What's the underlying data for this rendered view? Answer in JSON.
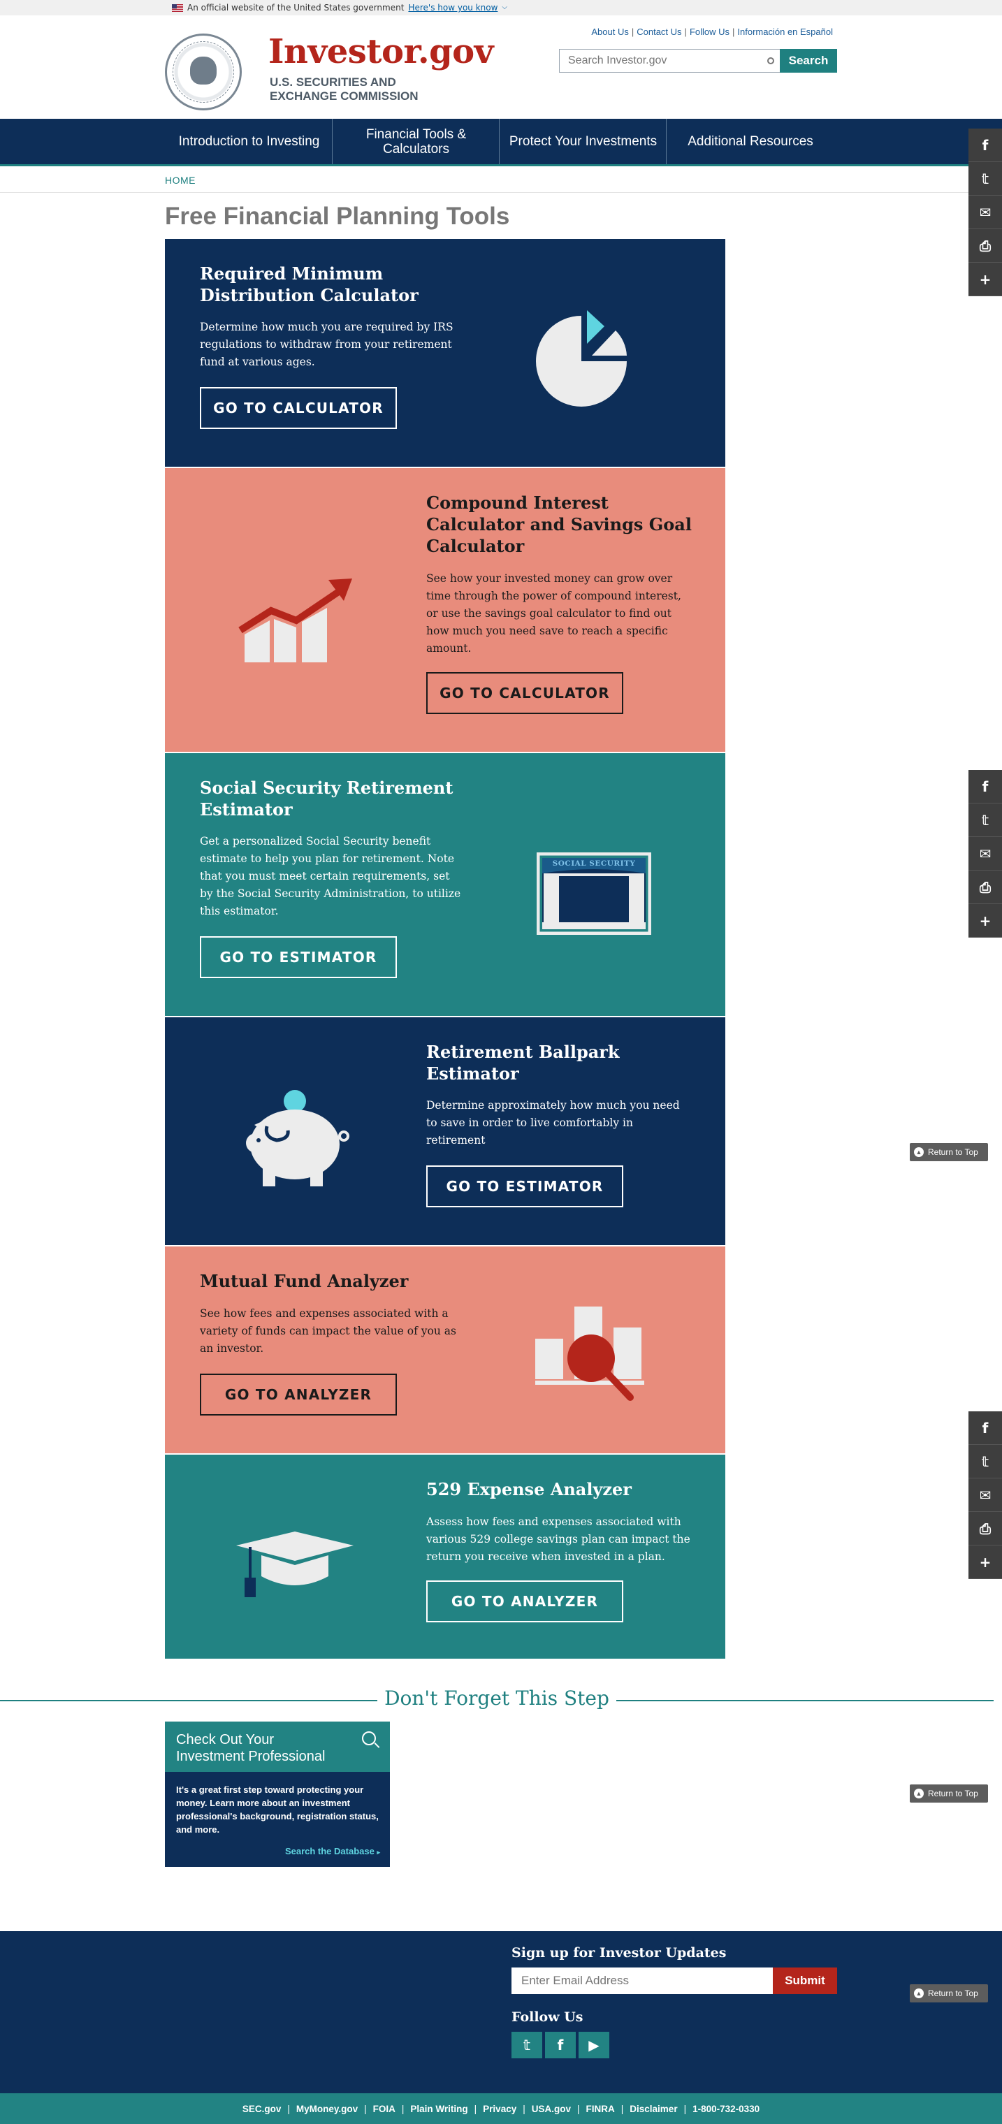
{
  "gov_banner": {
    "text": "An official website of the United States government",
    "link": "Here's how you know"
  },
  "header": {
    "brand": "Investor.gov",
    "agency": "U.S. SECURITIES AND EXCHANGE COMMISSION",
    "top_links": [
      "About Us",
      "Contact Us",
      "Follow Us",
      "Información en Español"
    ],
    "search_placeholder": "Search Investor.gov",
    "search_button": "Search"
  },
  "nav": [
    "Introduction to Investing",
    "Financial Tools & Calculators",
    "Protect Your Investments",
    "Additional Resources"
  ],
  "breadcrumb": "HOME",
  "page_title": "Free Financial Planning Tools",
  "tools": [
    {
      "title": "Required Minimum Distribution Calculator",
      "description": "Determine how much you are required by IRS regulations to withdraw from your retirement fund at various ages.",
      "cta": "GO TO CALCULATOR",
      "icon": "pie-chart-icon",
      "theme": "navy"
    },
    {
      "title": "Compound Interest Calculator and Savings Goal Calculator",
      "description": "See how your invested money can grow over time through the power of compound interest, or use the savings goal calculator to find out how much you need save to reach a specific amount.",
      "cta": "GO TO CALCULATOR",
      "icon": "growth-chart-icon",
      "theme": "salmon"
    },
    {
      "title": "Social Security Retirement Estimator",
      "description": "Get a personalized Social Security benefit estimate to help you plan for retirement. Note that you must meet certain requirements, set by the Social Security Administration, to utilize this estimator.",
      "cta": "GO TO ESTIMATOR",
      "icon": "social-security-building-icon",
      "icon_label": "SOCIAL SECURITY",
      "theme": "teal"
    },
    {
      "title": "Retirement Ballpark Estimator",
      "description": "Determine approximately how much you need to save in order to live comfortably in retirement",
      "cta": "GO TO ESTIMATOR",
      "icon": "piggy-bank-icon",
      "theme": "navy"
    },
    {
      "title": "Mutual Fund Analyzer",
      "description": "See how fees and expenses associated with a variety of funds can impact the value of you as an investor.",
      "cta": "GO TO ANALYZER",
      "icon": "magnified-bar-chart-icon",
      "theme": "salmon"
    },
    {
      "title": "529 Expense Analyzer",
      "description": "Assess how fees and expenses associated with various 529 college savings plan can impact the return you receive when invested in a plan.",
      "cta": "GO TO ANALYZER",
      "icon": "graduation-cap-icon",
      "theme": "teal"
    }
  ],
  "share_icons": [
    "facebook-icon",
    "twitter-icon",
    "email-icon",
    "print-icon",
    "plus-icon"
  ],
  "return_to_top": "Return to Top",
  "dont_forget": {
    "title": "Don't Forget This Step",
    "card_title": "Check Out Your Investment Professional",
    "card_body": "It's a great first step toward protecting your money. Learn more about an investment professional's background, registration status, and more.",
    "card_link": "Search the Database"
  },
  "footer": {
    "signup_label": "Sign up for Investor Updates",
    "email_placeholder": "Enter Email Address",
    "submit": "Submit",
    "follow_label": "Follow Us",
    "links": [
      "SEC.gov",
      "MyMoney.gov",
      "FOIA",
      "Plain Writing",
      "Privacy",
      "USA.gov",
      "FINRA",
      "Disclaimer",
      "1-800-732-0330"
    ]
  },
  "colors": {
    "navy": "#0d2e58",
    "teal": "#228383",
    "salmon": "#e88c7c",
    "brand_red": "#b4251b",
    "accent_cyan": "#5fd4e0"
  }
}
